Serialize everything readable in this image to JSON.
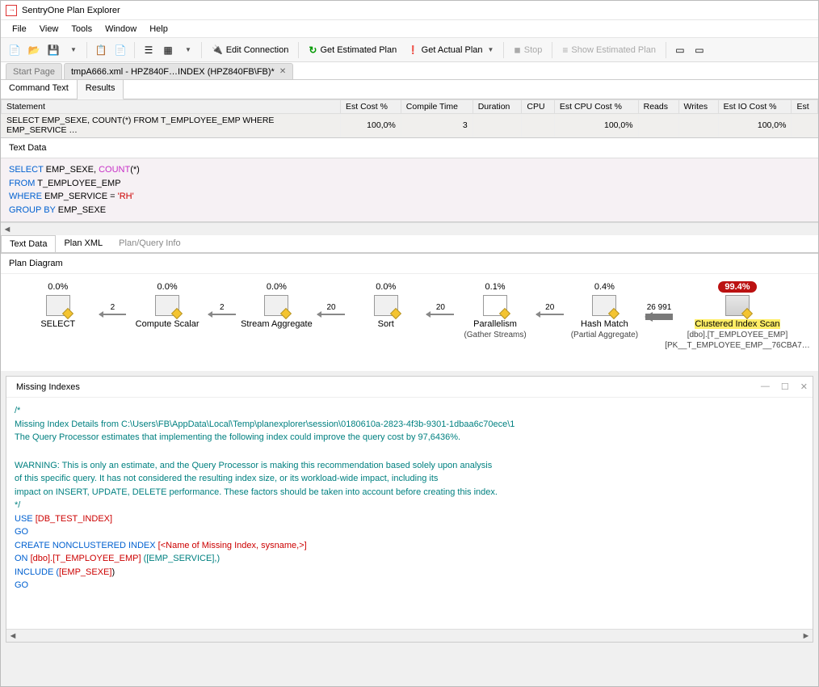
{
  "app_title": "SentryOne Plan Explorer",
  "menu": [
    "File",
    "View",
    "Tools",
    "Window",
    "Help"
  ],
  "toolbar": {
    "edit_connection": "Edit Connection",
    "estimated": "Get Estimated Plan",
    "actual": "Get Actual Plan",
    "stop": "Stop",
    "show_estimated": "Show Estimated Plan"
  },
  "tabs": {
    "start": "Start Page",
    "active": "tmpA666.xml - HPZ840F…INDEX (HPZ840FB\\FB)*"
  },
  "subtabs": {
    "command": "Command Text",
    "results": "Results"
  },
  "grid": {
    "cols": [
      "Statement",
      "Est Cost %",
      "Compile Time",
      "Duration",
      "CPU",
      "Est CPU Cost %",
      "Reads",
      "Writes",
      "Est IO Cost %",
      "Est"
    ],
    "row": {
      "stmt": "SELECT EMP_SEXE, COUNT(*) FROM T_EMPLOYEE_EMP WHERE EMP_SERVICE …",
      "estcost": "100,0%",
      "compile": "3",
      "duration": "",
      "cpu": "",
      "estcpu": "100,0%",
      "reads": "",
      "writes": "",
      "estio": "100,0%"
    }
  },
  "text_data_label": "Text Data",
  "sql": {
    "l1a": "SELECT",
    "l1b": " EMP_SEXE, ",
    "l1c": "COUNT",
    "l1d": "(*)",
    "l2a": "FROM",
    "l2b": "   T_EMPLOYEE_EMP",
    "l3a": "WHERE",
    "l3b": "  EMP_SERVICE = ",
    "l3c": "'RH'",
    "l4a": "GROUP",
    "l4b": "  ",
    "l4c": "BY",
    "l4d": " EMP_SEXE"
  },
  "bottom_tabs": [
    "Text Data",
    "Plan XML",
    "Plan/Query Info"
  ],
  "plan_label": "Plan Diagram",
  "plan": {
    "nodes": [
      {
        "pct": "0.0%",
        "label": "SELECT",
        "sub": ""
      },
      {
        "pct": "0.0%",
        "label": "Compute Scalar",
        "sub": ""
      },
      {
        "pct": "0.0%",
        "label": "Stream Aggregate",
        "sub": ""
      },
      {
        "pct": "0.0%",
        "label": "Sort",
        "sub": ""
      },
      {
        "pct": "0.1%",
        "label": "Parallelism",
        "sub": "(Gather Streams)"
      },
      {
        "pct": "0.4%",
        "label": "Hash Match",
        "sub": "(Partial Aggregate)"
      },
      {
        "pct": "99.4%",
        "label": "Clustered Index Scan",
        "sub": "[dbo].[T_EMPLOYEE_EMP]",
        "sub2": "[PK__T_EMPLOYEE_EMP__76CBA7…"
      }
    ],
    "rows": [
      "2",
      "2",
      "20",
      "20",
      "20",
      "26 991"
    ]
  },
  "missing": {
    "title": "Missing Indexes",
    "comment_open": "/*",
    "l1": "Missing Index Details from C:\\Users\\FB\\AppData\\Local\\Temp\\planexplorer\\session\\0180610a-2823-4f3b-9301-1dbaa6c70ece\\1",
    "l2": "The Query Processor estimates that implementing the following index could improve the query cost by 97,6436%.",
    "w1": "WARNING: This is only an estimate, and the Query Processor is making this recommendation based solely upon analysis",
    "w2": "of this specific query. It has not considered the resulting index size, or its workload-wide impact, including its",
    "w3": "impact on INSERT, UPDATE, DELETE performance. These factors should be taken into account before creating this index.",
    "comment_close": "*/",
    "use": "USE ",
    "db": "[DB_TEST_INDEX]",
    "go": "GO",
    "create": "CREATE NONCLUSTERED INDEX ",
    "idxname": "[<Name of Missing Index, sysname,>]",
    "on": "ON ",
    "ontbl": "[dbo].[T_EMPLOYEE_EMP]",
    "oncol": " ([EMP_SERVICE],)",
    "include": "INCLUDE (",
    "inccol": "[EMP_SEXE]",
    "incend": ")"
  }
}
